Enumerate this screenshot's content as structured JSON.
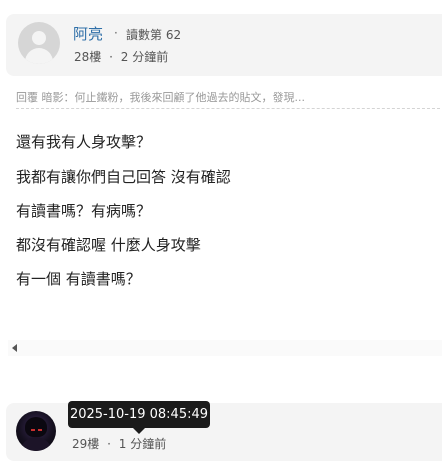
{
  "post": {
    "author": "阿亮",
    "separator": "·",
    "read_count": "讀數第 62",
    "floor": "28樓",
    "time": "2 分鐘前"
  },
  "reply_preview": "回覆 暗影：何止鐵粉，我後來回顧了他過去的貼文，發現...",
  "content_lines": [
    "還有我有人身攻擊？",
    "我都有讓你們自己回答 沒有確認",
    "有讀書嗎？有病嗎？",
    "都沒有確認喔 什麼人身攻擊",
    "有一個 有讀書嗎？"
  ],
  "next_post": {
    "floor": "29樓",
    "separator": "·",
    "time": "1 分鐘前"
  },
  "tooltip": {
    "timestamp": "2025-10-19 08:45:49"
  },
  "icons": {
    "scroll_left": "chevron-left-icon"
  }
}
